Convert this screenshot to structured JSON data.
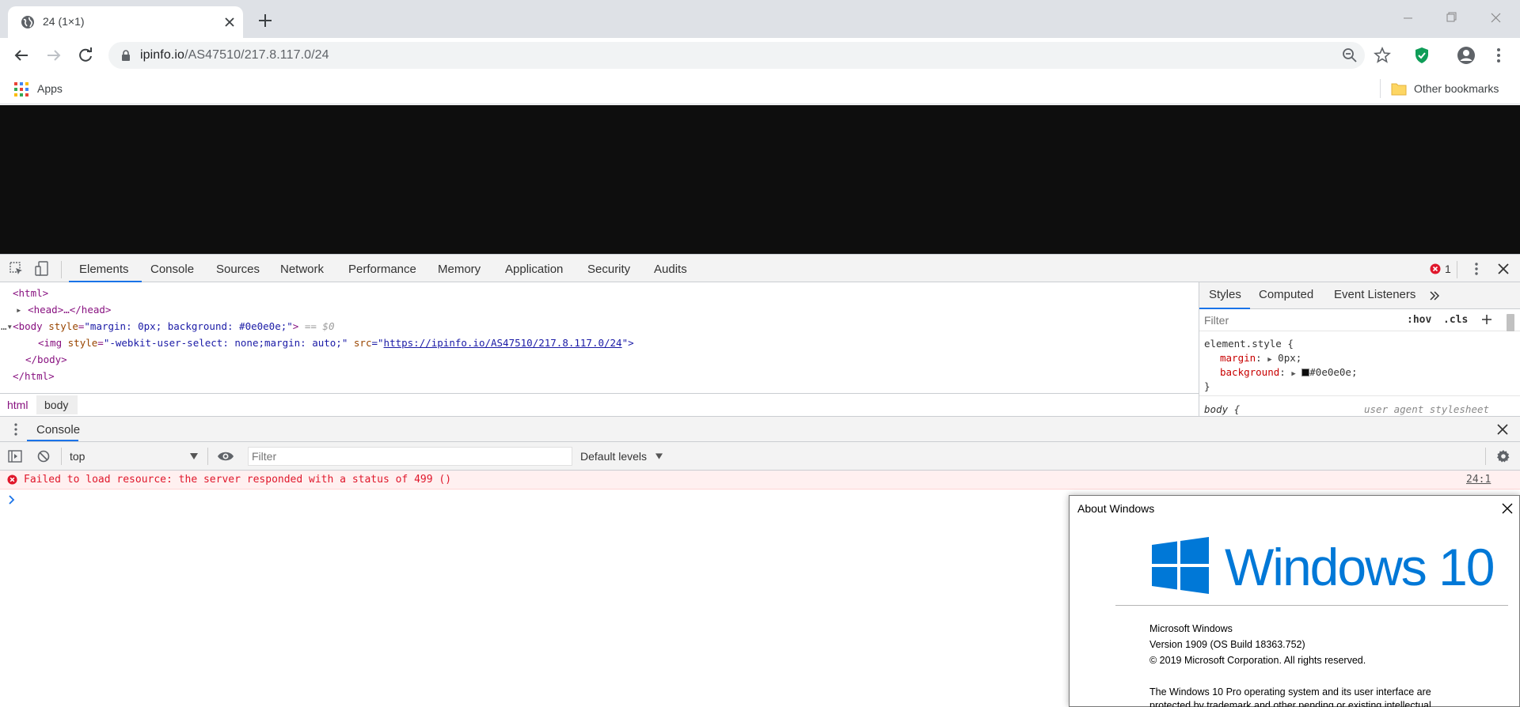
{
  "browser": {
    "tab_title": "24 (1×1)",
    "url_host": "ipinfo.io",
    "url_path": "/AS47510/217.8.117.0/24",
    "bookmarks": {
      "apps": "Apps",
      "other": "Other bookmarks"
    }
  },
  "devtools": {
    "tabs": [
      "Elements",
      "Console",
      "Sources",
      "Network",
      "Performance",
      "Memory",
      "Application",
      "Security",
      "Audits"
    ],
    "error_count": "1",
    "dom": {
      "html_open": "<html>",
      "head": "<head>…</head>",
      "body_tag": "<body ",
      "body_attr": "style",
      "body_val": "\"margin: 0px; background: #0e0e0e;\"",
      "body_close": ">",
      "selected_marker": "== $0",
      "img_open": "<img ",
      "img_attr1": "style",
      "img_val1": "\"-webkit-user-select: none;margin: auto;\"",
      "img_attr2": " src",
      "img_eq": "=\"",
      "img_src": "https://ipinfo.io/AS47510/217.8.117.0/24",
      "img_close": "\">",
      "body_end": "</body>",
      "html_end": "</html>"
    },
    "breadcrumbs": [
      "html",
      "body"
    ],
    "styles_tabs": [
      "Styles",
      "Computed",
      "Event Listeners"
    ],
    "styles_filter_placeholder": "Filter",
    "hov": ":hov",
    "cls": ".cls",
    "element_style": {
      "selector": "element.style {",
      "prop1": "margin",
      "val1": "0px;",
      "prop2": "background",
      "val2": "#0e0e0e;",
      "close": "}",
      "next_selector": "body {",
      "next_origin": "user agent stylesheet"
    },
    "drawer_tab": "Console",
    "console": {
      "context": "top",
      "filter_placeholder": "Filter",
      "levels": "Default levels",
      "error_message": "Failed to load resource: the server responded with a status of 499 ()",
      "error_source": "24:1"
    }
  },
  "about_windows": {
    "title": "About Windows",
    "wordmark": "Windows 10",
    "product": "Microsoft Windows",
    "version": "Version 1909 (OS Build 18363.752)",
    "copyright": "© 2019 Microsoft Corporation. All rights reserved.",
    "legal_line1": "The Windows 10 Pro operating system and its user interface are",
    "legal_line2": "protected by trademark and other pending or existing intellectual"
  },
  "colors": {
    "page_background": "#0e0e0e",
    "windows_blue": "#0078d7",
    "devtools_accent": "#1a73e8",
    "error_red": "#e0172b"
  }
}
